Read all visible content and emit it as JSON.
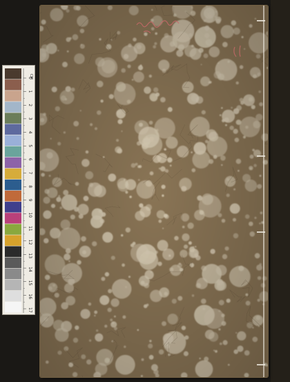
{
  "scene": {
    "background_color": "#1a1815",
    "cover_base_color": "#8a7556",
    "spot_color": "#d8ccb4",
    "thread_color": "#f0ece2",
    "handwriting_color": "#c9686a"
  },
  "cover": {
    "handwriting": "",
    "stamp_lines": [
      "",
      "",
      ""
    ],
    "stamp_number": ""
  },
  "color_card": {
    "unit_label": "CM",
    "ruler_numbers": [
      "0",
      "1",
      "2",
      "3",
      "4",
      "5",
      "6",
      "7",
      "8",
      "9",
      "10",
      "11",
      "12",
      "13",
      "14",
      "15",
      "16",
      "17"
    ],
    "patches": [
      "#4a3a2e",
      "#8b5e4d",
      "#c9a48d",
      "#a3b6c9",
      "#6b7d5a",
      "#5e6a9e",
      "#9ab0d8",
      "#6aa49c",
      "#8d63a8",
      "#d6ac3a",
      "#2c5d8e",
      "#c06a3a",
      "#3f3f8c",
      "#b9407a",
      "#8aa83e",
      "#d7a22c",
      "#2b2b2b",
      "#5a5a5a",
      "#8a8a8a",
      "#b5b5b5",
      "#dedede",
      "#f5f5f5"
    ]
  }
}
